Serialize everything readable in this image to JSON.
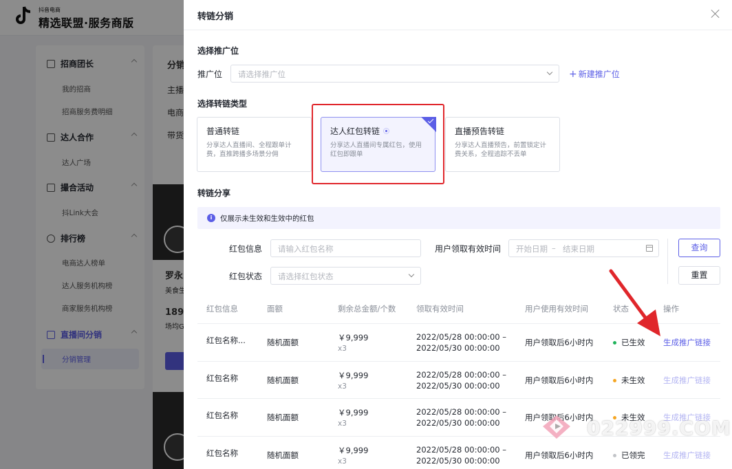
{
  "background": {
    "logo_small": "抖音电商",
    "logo_big": "精选联盟·服务商版",
    "sidebar": {
      "groups": [
        {
          "label": "招商团长",
          "items": [
            "我的招商",
            "招商服务费明细"
          ]
        },
        {
          "label": "达人合作",
          "items": [
            "达人广场"
          ]
        },
        {
          "label": "撮合活动",
          "items": [
            "抖Link大会"
          ]
        },
        {
          "label": "排行榜",
          "items": [
            "电商达人榜单",
            "达人服务机构榜",
            "商家服务机构榜"
          ]
        },
        {
          "label": "直播间分销",
          "items": [
            "分销管理"
          ]
        }
      ]
    },
    "main_texts": [
      "分销",
      "主播",
      "电商",
      "带货",
      "罗永",
      "美食生",
      "189",
      "场均G"
    ]
  },
  "drawer": {
    "title": "转链分销",
    "section_promo": "选择推广位",
    "promo_label": "推广位",
    "promo_placeholder": "请选择推广位",
    "add_promo_link": "新建推广位",
    "section_type": "选择转链类型",
    "types": [
      {
        "title": "普通转链",
        "desc": "分享达人直播间、全程跟单计费，直推跨播多场景分佣"
      },
      {
        "title": "达人红包转链",
        "desc": "分享达人直播间专属红包，使用红包即跟单"
      },
      {
        "title": "直播预告转链",
        "desc": "分享达人直播预告，前置锁定计费关系，全程追踪不丢单"
      }
    ],
    "section_share": "转链分享",
    "notice": "仅展示未生效和生效中的红包",
    "filters": {
      "hb_info_label": "红包信息",
      "hb_info_placeholder": "请输入红包名称",
      "valid_time_label": "用户领取有效时间",
      "start_placeholder": "开始日期",
      "range_sep": "–",
      "end_placeholder": "结束日期",
      "hb_status_label": "红包状态",
      "hb_status_placeholder": "请选择红包状态",
      "query_button": "查询",
      "reset_button": "重置"
    },
    "table": {
      "headers": [
        "红包信息",
        "面额",
        "剩余总金额/个数",
        "领取有效时间",
        "用户使用有效时间",
        "状态",
        "操作"
      ],
      "rows": [
        {
          "name": "红包名称...",
          "face": "随机面额",
          "amount": "￥9,999",
          "count": "x3",
          "time1": "2022/05/28 00:00:00 –",
          "time2": "2022/05/30 00:00:00",
          "use_time": "用户领取后6小时内",
          "status": "已生效",
          "status_color": "#1fb35a",
          "action": "生成推广链接",
          "action_enabled": true
        },
        {
          "name": "红包名称",
          "face": "随机面额",
          "amount": "￥9,999",
          "count": "x3",
          "time1": "2022/05/28 00:00:00 –",
          "time2": "2022/05/30 00:00:00",
          "use_time": "用户领取后6小时内",
          "status": "未生效",
          "status_color": "#f5a623",
          "action": "生成推广链接",
          "action_enabled": false
        },
        {
          "name": "红包名称",
          "face": "随机面额",
          "amount": "￥9,999",
          "count": "x3",
          "time1": "2022/05/28 00:00:00 –",
          "time2": "2022/05/30 00:00:00",
          "use_time": "用户领取后6小时内",
          "status": "未生效",
          "status_color": "#f5a623",
          "action": "生成推广链接",
          "action_enabled": false
        },
        {
          "name": "红包名称",
          "face": "随机面额",
          "amount": "￥9,999",
          "count": "x3",
          "time1": "2022/05/28 00:00:00 –",
          "time2": "2022/05/30 00:00:00",
          "use_time": "用户领取后6小时内",
          "status": "已领完",
          "status_color": "#c2c4c8",
          "action": "生成推广链接",
          "action_enabled": false
        }
      ]
    }
  },
  "watermark": "022999.COM",
  "colors": {
    "accent": "#5b5ee6",
    "annotation_red": "#e0262b"
  }
}
